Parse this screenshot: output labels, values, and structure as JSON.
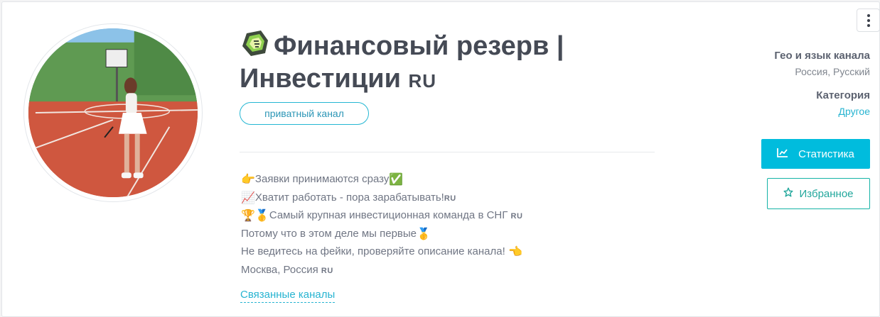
{
  "channel": {
    "title_line1": "Финансовый резерв |",
    "title_line2": "Инвестиции",
    "title_flag": "RU",
    "badge": "приватный канал"
  },
  "description": {
    "lines": [
      {
        "pre_icon": "👉",
        "text": "Заявки принимаются сразу",
        "post_icon": "✅",
        "flag": ""
      },
      {
        "pre_icon": "📈",
        "text": "Хватит работать - пора зарабатывать!",
        "post_icon": "",
        "flag": "RU"
      },
      {
        "pre_icon": "🏆🥇",
        "text": "Самый крупная инвестиционная команда в СНГ ",
        "post_icon": "",
        "flag": "RU"
      },
      {
        "pre_icon": "",
        "text": "Потому что в этом деле мы первые",
        "post_icon": "🥇",
        "flag": ""
      },
      {
        "pre_icon": "",
        "text": "Не ведитесь на фейки, проверяйте описание канала! ",
        "post_icon": "👈",
        "flag": ""
      },
      {
        "pre_icon": "",
        "text": "Москва, Россия ",
        "post_icon": "",
        "flag": "RU"
      }
    ],
    "related_link": "Связанные каналы"
  },
  "sidebar": {
    "geo_label": "Гео и язык канала",
    "geo_value": "Россия, Русский",
    "category_label": "Категория",
    "category_value": "Другое",
    "stats_button": "Статистика",
    "favorite_button": "Избранное"
  },
  "icons": {
    "menu": "more-vertical-icon",
    "stats": "chart-line-icon",
    "favorite": "star-outline-icon",
    "title": "money-cube-icon"
  },
  "colors": {
    "accent": "#00bcdd",
    "link": "#27b4d1",
    "favorite": "#14b3a6",
    "title": "#454a55"
  }
}
